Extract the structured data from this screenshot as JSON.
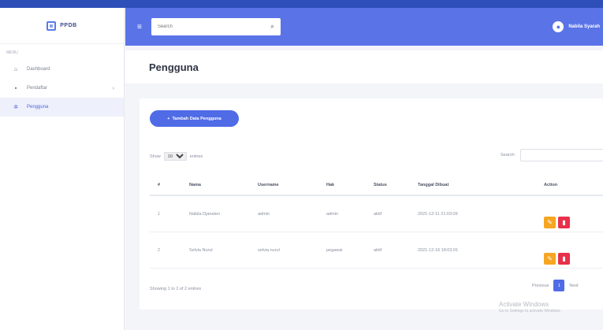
{
  "brand": {
    "name": "PPDB"
  },
  "sidebar": {
    "section": "Menu",
    "items": [
      {
        "label": "Dashboard",
        "icon": "home-icon"
      },
      {
        "label": "Pendaftar",
        "icon": "folder-icon"
      },
      {
        "label": "Pengguna",
        "icon": "users-icon"
      }
    ]
  },
  "header": {
    "search_placeholder": "Search",
    "user_name": "Nabila Syarah"
  },
  "page": {
    "title": "Pengguna"
  },
  "card": {
    "add_button": "Tambah Data Pengguna",
    "show_label": "Show",
    "show_value": "10",
    "entries_label": "entries",
    "search_label": "Search:"
  },
  "table": {
    "headers": [
      "#",
      "Nama",
      "Username",
      "Hak",
      "Status",
      "Tanggal Dibuat",
      "Action"
    ],
    "rows": [
      {
        "no": "1",
        "nama": "Nabila Djanaten",
        "username": "admin",
        "hak": "admin",
        "status": "aktif",
        "tanggal": "2021-12-11 21:03:09"
      },
      {
        "no": "2",
        "nama": "Selvia Nurul",
        "username": "selvia.nurul",
        "hak": "pegawai",
        "status": "aktif",
        "tanggal": "2021-12-16 18:03:01"
      }
    ]
  },
  "footer": {
    "info": "Showing 1 to 2 of 2 entries",
    "prev": "Previous",
    "page": "1",
    "next": "Next"
  },
  "watermark": {
    "line1": "Activate Windows",
    "line2": "Go to Settings to activate Windows."
  },
  "colors": {
    "header": "#5a74e8",
    "primary": "#4f6be6",
    "edit": "#f6a623",
    "delete": "#e8314a"
  }
}
